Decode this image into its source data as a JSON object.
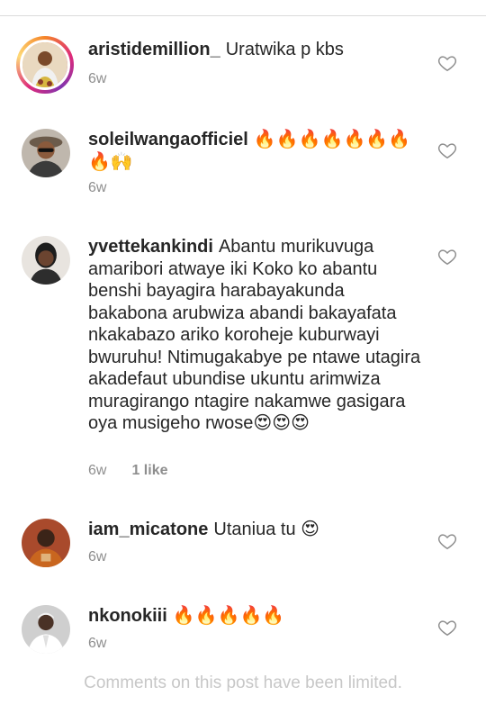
{
  "comments": [
    {
      "username": "aristidemillion_",
      "text": "Uratwika p kbs",
      "time": "6w",
      "likes": "",
      "avatar_icon": "avatar-photo-story-ring"
    },
    {
      "username": "soleilwangaofficiel",
      "text": "🔥🔥🔥🔥🔥🔥🔥🔥🙌",
      "time": "6w",
      "likes": "",
      "avatar_icon": "avatar-photo"
    },
    {
      "username": "yvettekankindi",
      "text": "Abantu murikuvuga amaribori atwaye iki Koko ko abantu benshi bayagira harabayakunda bakabona arubwiza abandi bakayafata nkakabazo ariko koroheje kuburwayi bwuruhu! Ntimugakabye pe ntawe utagira akadefaut ubundise ukuntu arimwiza muragirango ntagire nakamwe gasigara oya musigeho rwose😍😍😍",
      "time": "6w",
      "likes": "1 like",
      "avatar_icon": "avatar-photo"
    },
    {
      "username": "iam_micatone",
      "text": "Utaniua tu 😍",
      "time": "6w",
      "likes": "",
      "avatar_icon": "avatar-photo"
    },
    {
      "username": "nkonokiii",
      "text": "🔥🔥🔥🔥🔥",
      "time": "6w",
      "likes": "",
      "avatar_icon": "avatar-photo"
    }
  ],
  "footer": "Comments on this post have been limited.",
  "icons": {
    "like": "heart-outline-icon"
  },
  "colors": {
    "story_ring": "#dd2a7b",
    "meta": "#8e8e8e",
    "footer": "#c7c7c7"
  }
}
